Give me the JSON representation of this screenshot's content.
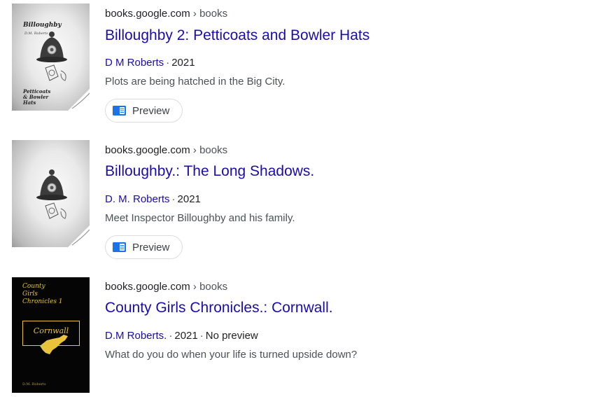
{
  "results": [
    {
      "cover": {
        "title": "Billoughby",
        "author": "D.M. Roberts",
        "subtitle_lines": [
          "Petticoats",
          "& Bowler",
          "Hats"
        ]
      },
      "url_domain": "books.google.com",
      "url_crumb": "› books",
      "title": "Billoughby 2: Petticoats and Bowler Hats",
      "author": "D M Roberts",
      "year": "2021",
      "snippet": "Plots are being hatched in the Big City.",
      "preview_label": "Preview",
      "preview_icon": "book-preview-icon"
    },
    {
      "url_domain": "books.google.com",
      "url_crumb": "› books",
      "title": "Billoughby.: The Long Shadows.",
      "author": "D. M. Roberts",
      "year": "2021",
      "snippet": "Meet Inspector Billoughby and his family.",
      "preview_label": "Preview",
      "preview_icon": "book-preview-icon"
    },
    {
      "cover": {
        "series_lines": [
          "County",
          "Girls",
          "Chronicles 1"
        ],
        "boxed_title": "Cornwall",
        "author": "D.M. Roberts"
      },
      "url_domain": "books.google.com",
      "url_crumb": "› books",
      "title": "County Girls Chronicles.: Cornwall.",
      "author": "D.M Roberts.",
      "year": "2021",
      "availability": "No preview",
      "snippet": "What do you do when your life is turned upside down?"
    }
  ],
  "colors": {
    "link": "#1a0dab",
    "text": "#202124",
    "muted": "#4d5156",
    "accent_gold": "#e9c33a",
    "preview_blue": "#1a73e8"
  }
}
